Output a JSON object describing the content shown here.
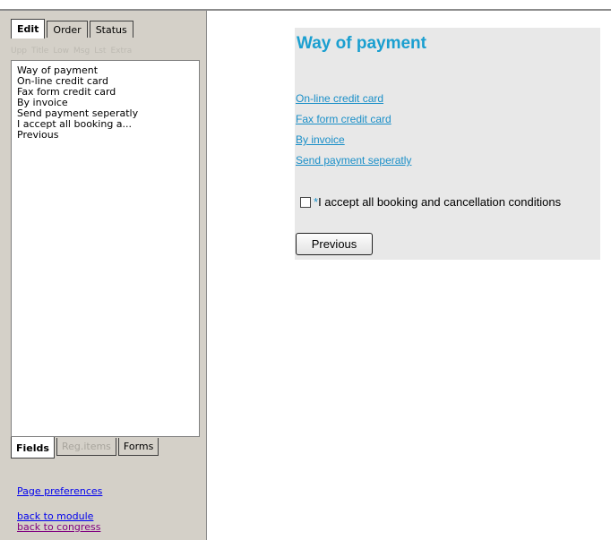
{
  "left": {
    "top_tabs": [
      "Edit",
      "Order",
      "Status"
    ],
    "toolbar": [
      "Upp",
      "Title",
      "Low",
      "Msg",
      "Lst",
      "Extra"
    ],
    "fields": [
      "Way of payment",
      "On-line credit card",
      "Fax form credit card",
      "By invoice",
      "Send payment seperatly",
      "I accept all booking a...",
      "Previous"
    ],
    "bottom_tabs": [
      "Fields",
      "Reg.items",
      "Forms"
    ],
    "links": {
      "page_preferences": "Page preferences",
      "back_to_module": "back to module",
      "back_to_congress": "back to congress"
    }
  },
  "content": {
    "heading": "Way of payment",
    "payment_links": [
      "On-line credit card",
      "Fax form credit card",
      "By invoice",
      "Send payment seperatly"
    ],
    "required_marker": "*",
    "accept_text": "I accept all booking and cancellation conditions",
    "checkbox_checked": false,
    "previous_button": "Previous"
  },
  "colors": {
    "heading": "#1a9fd0",
    "link": "#1a8fc8",
    "panel_bg": "#d4d0c8",
    "content_bg": "#e8e8e8"
  }
}
